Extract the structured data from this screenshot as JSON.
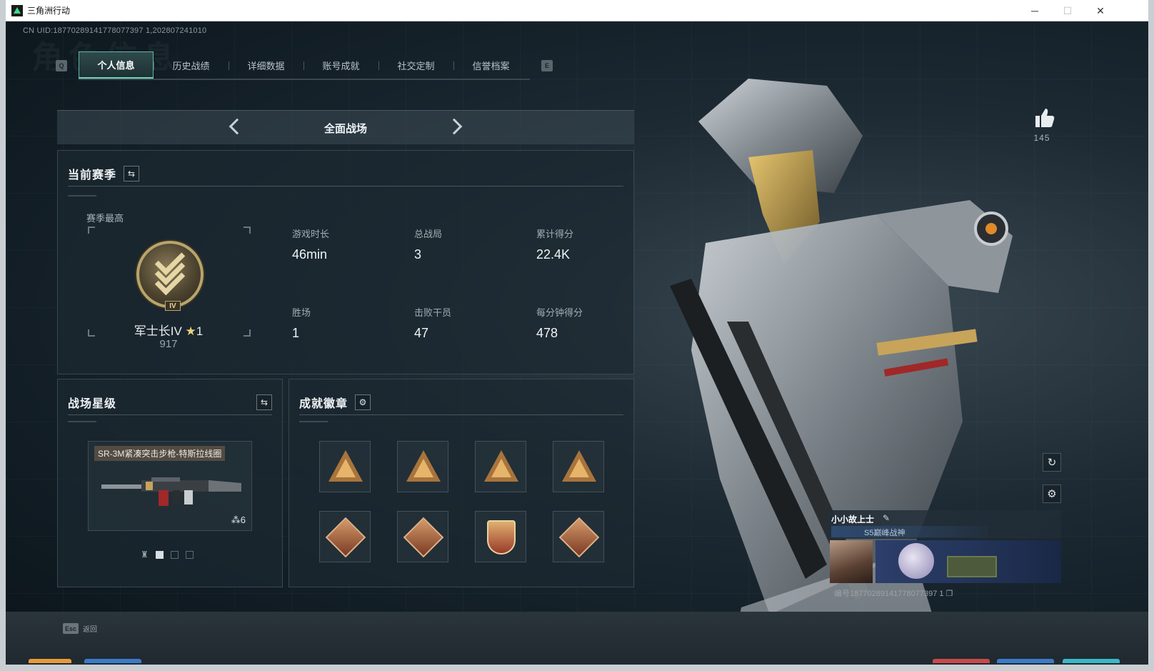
{
  "window": {
    "title": "三角洲行动",
    "controls": {
      "minimize": "─",
      "maximize": "☐",
      "close": "✕"
    }
  },
  "header": {
    "uid": "CN UID:18770289141778077397 1,202807241010",
    "background_title": "角色信息"
  },
  "tabs": {
    "left_key": "Q",
    "right_key": "E",
    "items": [
      {
        "label": "个人信息",
        "active": true
      },
      {
        "label": "历史战绩",
        "active": false
      },
      {
        "label": "详细数据",
        "active": false
      },
      {
        "label": "账号成就",
        "active": false
      },
      {
        "label": "社交定制",
        "active": false
      },
      {
        "label": "信誉档案",
        "active": false
      }
    ]
  },
  "mode": {
    "label": "全面战场"
  },
  "season": {
    "title": "当前赛季",
    "best_label": "赛季最高",
    "rank_name": "军士长IV",
    "rank_stars": "1",
    "rank_tier": "IV",
    "rank_score": "917",
    "stats": [
      {
        "label": "游戏时长",
        "value": "46min"
      },
      {
        "label": "总战局",
        "value": "3"
      },
      {
        "label": "累计得分",
        "value": "22.4K"
      },
      {
        "label": "胜场",
        "value": "1"
      },
      {
        "label": "击败干员",
        "value": "47"
      },
      {
        "label": "每分钟得分",
        "value": "478"
      }
    ]
  },
  "battlefield_star": {
    "title": "战场星级",
    "weapon_name": "SR-3M紧凑突击步枪-特斯拉线圈",
    "weapon_star_count": "6",
    "pages": 3,
    "active_page": 1
  },
  "badges": {
    "title": "成就徽章",
    "items": [
      {
        "icon": "triangle-gold-badge-icon"
      },
      {
        "icon": "triangle-gold-badge-icon"
      },
      {
        "icon": "triangle-gold-badge-icon"
      },
      {
        "icon": "triangle-gold-badge-icon"
      },
      {
        "icon": "dragon-diamond-badge-icon"
      },
      {
        "icon": "dragon-diamond-badge-icon"
      },
      {
        "icon": "eagle-shield-badge-icon"
      },
      {
        "icon": "wolf-diamond-badge-icon"
      }
    ]
  },
  "profile": {
    "likes": "145",
    "player_name": "小小故上士",
    "player_title": "S5巅峰战神",
    "player_id": "编号18770289141778077397 1"
  },
  "footer": {
    "esc_key": "Esc",
    "esc_label": "返回"
  },
  "colors": {
    "accent": "#6fd6bd",
    "panel_bg": "#1c2830",
    "gold": "#b8a56e"
  }
}
